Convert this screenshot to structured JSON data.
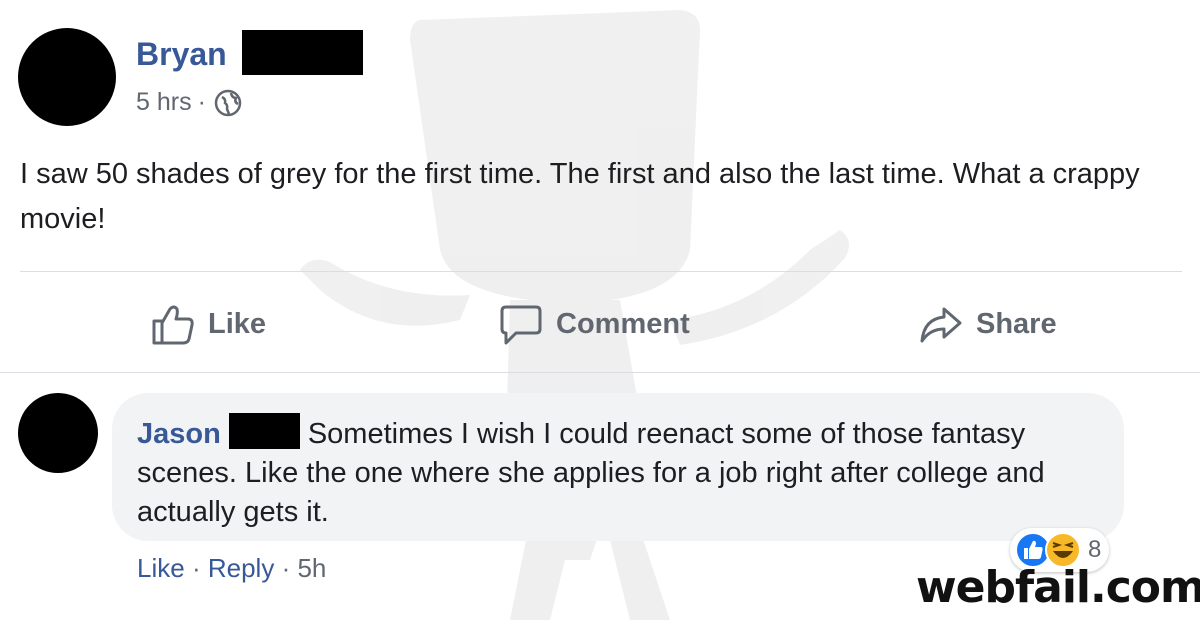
{
  "post": {
    "author": "Bryan",
    "time": "5 hrs",
    "meta_separator": "·",
    "privacy_icon": "globe-icon",
    "body": "I saw 50 shades of grey for the first time. The first and also the last time. What a crappy movie!"
  },
  "actions": {
    "like": "Like",
    "comment": "Comment",
    "share": "Share"
  },
  "comment": {
    "author": "Jason",
    "text": "Sometimes I wish I could reenact some of those fantasy scenes. Like the one where she applies for a job right after college and actually gets it.",
    "like": "Like",
    "reply": "Reply",
    "separator": "·",
    "time": "5h",
    "reaction_count": "8",
    "reaction_icons": [
      "like-reaction-icon",
      "haha-reaction-icon"
    ]
  },
  "branding": {
    "text": "webfail.com"
  },
  "colors": {
    "link_blue": "#385898",
    "meta_gray": "#606770",
    "bubble_bg": "#f2f3f5",
    "like_blue": "#1877f2",
    "haha_yellow": "#f7b928"
  }
}
